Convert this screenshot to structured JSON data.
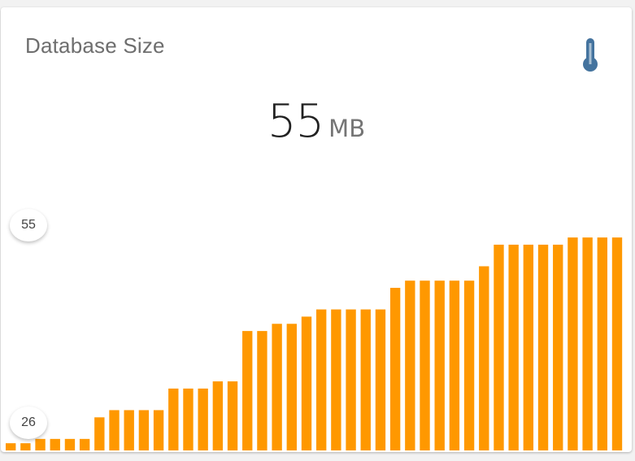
{
  "card": {
    "title": "Database Size",
    "icon": "thermometer-icon",
    "value": "55",
    "unit": "MB"
  },
  "axis": {
    "max_label": "55",
    "min_label": "26"
  },
  "colors": {
    "bar": "#ff9800",
    "icon": "#44739e",
    "title": "#6e6e6e"
  },
  "chart_data": {
    "type": "bar",
    "ylim": [
      24.4,
      60
    ],
    "values": [
      25.4,
      25.4,
      26.0,
      26.0,
      26.0,
      26.0,
      29.0,
      30.0,
      30.0,
      30.0,
      30.0,
      33.0,
      33.0,
      33.0,
      34.0,
      34.0,
      41.0,
      41.0,
      42.0,
      42.0,
      43.0,
      44.0,
      44.0,
      44.0,
      44.0,
      44.0,
      47.0,
      48.0,
      48.0,
      48.0,
      48.0,
      48.0,
      50.0,
      53.0,
      53.0,
      53.0,
      53.0,
      53.0,
      54.0,
      54.0,
      54.0,
      54.0
    ]
  }
}
